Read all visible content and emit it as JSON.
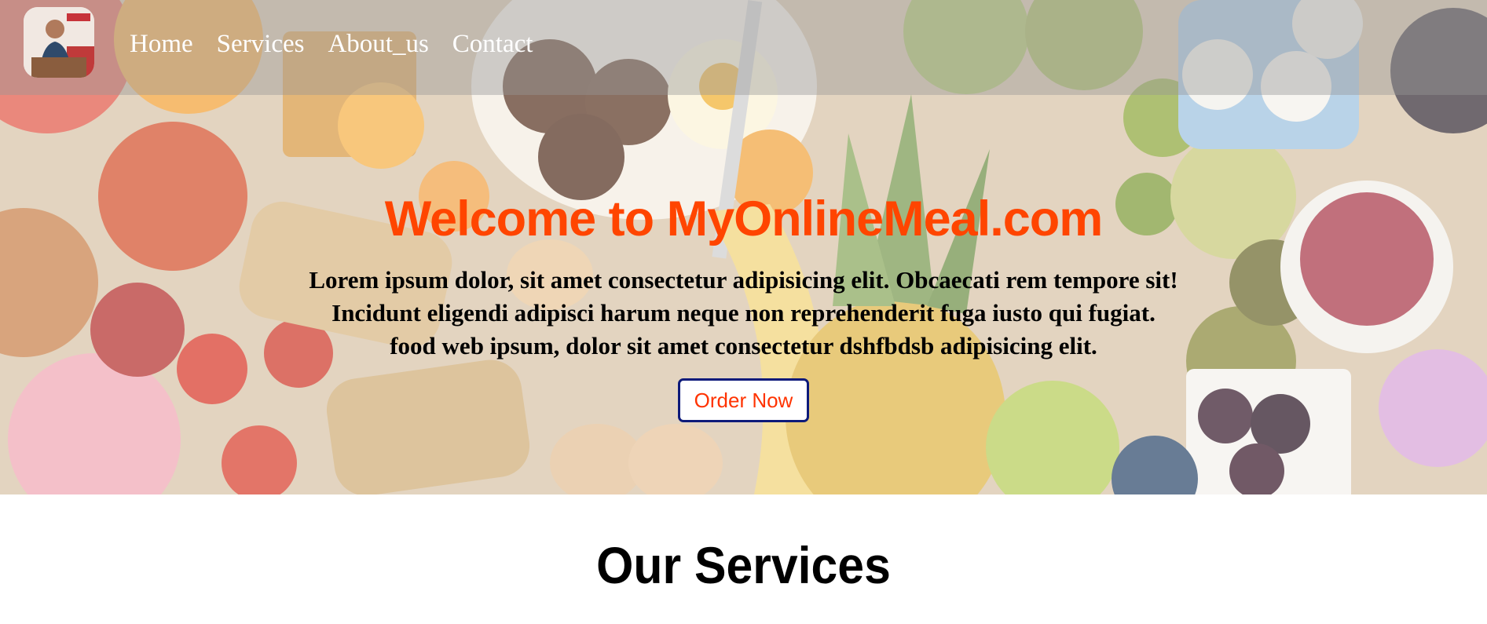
{
  "nav": {
    "logo_alt": "MyOnlineMeal logo",
    "links": [
      "Home",
      "Services",
      "About_us",
      "Contact"
    ]
  },
  "hero": {
    "title": "Welcome to MyOnlineMeal.com",
    "lines": [
      "Lorem ipsum dolor, sit amet consectetur adipisicing elit. Obcaecati rem tempore sit!",
      "Incidunt eligendi adipisci harum neque non reprehenderit fuga iusto qui fugiat.",
      "food web ipsum, dolor sit amet consectetur dshfbdsb adipisicing elit."
    ],
    "cta_label": "Order Now",
    "background": "food-spread-photo"
  },
  "services": {
    "title": "Our Services"
  },
  "colors": {
    "title_accent": "#ff4500",
    "button_border": "#0d1a7a",
    "button_text": "#ff3300",
    "nav_text": "#ffffff"
  }
}
